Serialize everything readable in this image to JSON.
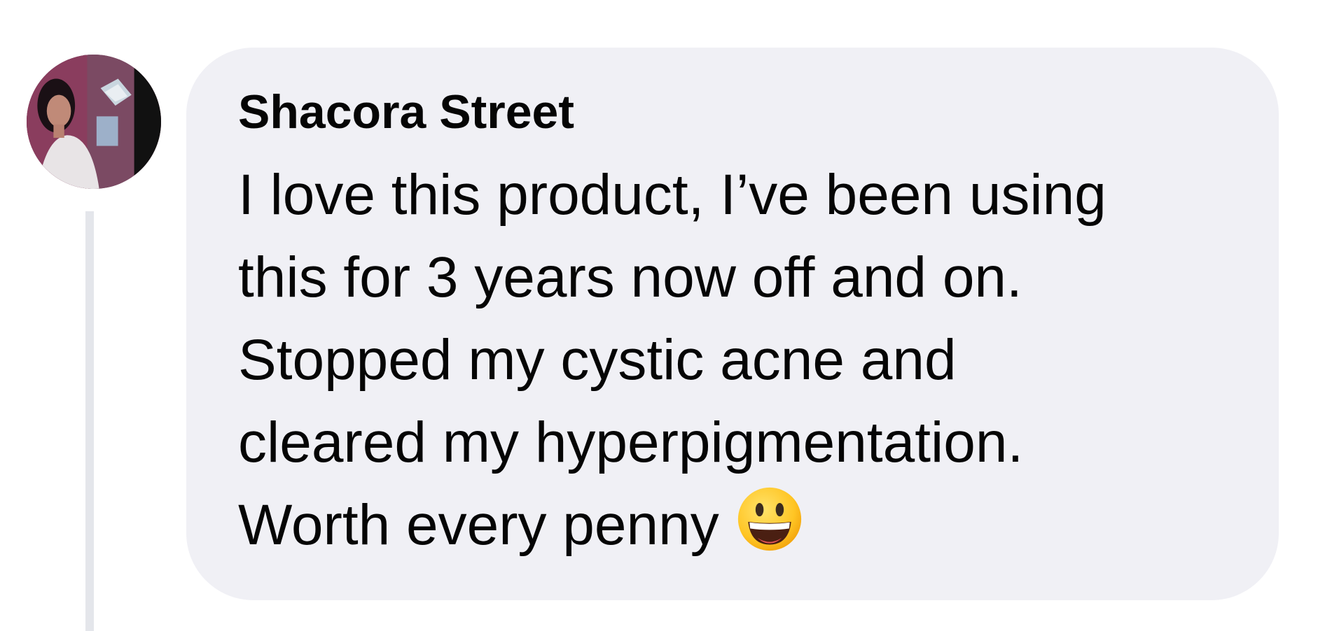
{
  "comment": {
    "author": "Shacora Street",
    "lines": [
      "I love this product, I’ve been using",
      "this for 3 years now off and on.",
      "Stopped my cystic acne and",
      "cleared my hyperpigmentation.",
      "Worth every penny"
    ],
    "emoji": "grinning-face-emoji"
  },
  "colors": {
    "bubble": "#f0f0f5",
    "text": "#050505",
    "thread_line": "#e4e6eb"
  }
}
